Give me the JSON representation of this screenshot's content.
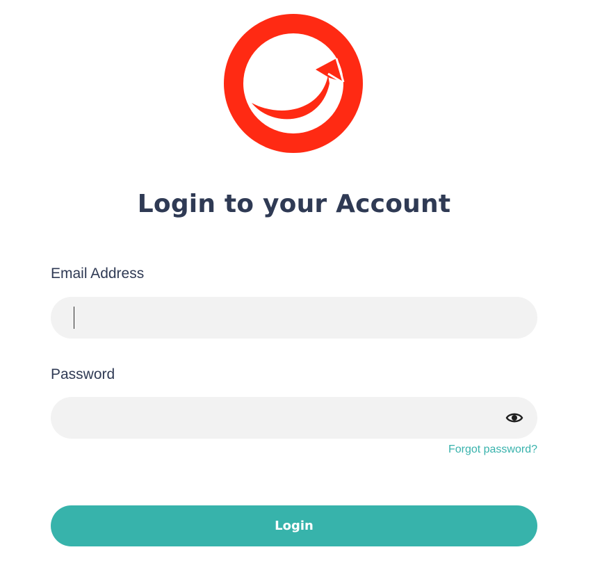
{
  "colors": {
    "brand_red": "#ff2a13",
    "accent_teal": "#37b3ab",
    "title_text": "#2f3a54",
    "input_bg": "#f2f2f2"
  },
  "logo": {
    "icon": "sitecore-logo-icon"
  },
  "page": {
    "title": "Login to your Account"
  },
  "form": {
    "email": {
      "label": "Email Address",
      "value": "",
      "placeholder": ""
    },
    "password": {
      "label": "Password",
      "value": "",
      "placeholder": "",
      "toggle_icon": "eye-icon"
    },
    "forgot_link": "Forgot password?",
    "submit_label": "Login"
  }
}
